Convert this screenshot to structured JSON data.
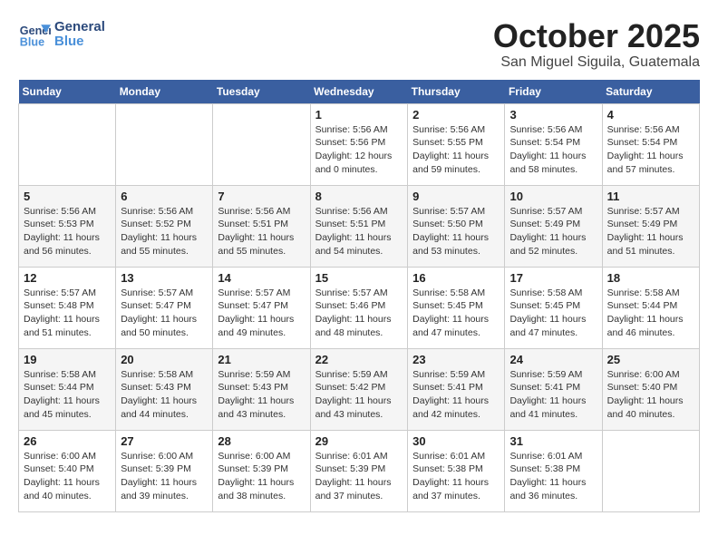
{
  "header": {
    "logo_line1": "General",
    "logo_line2": "Blue",
    "month_title": "October 2025",
    "location": "San Miguel Siguila, Guatemala"
  },
  "weekdays": [
    "Sunday",
    "Monday",
    "Tuesday",
    "Wednesday",
    "Thursday",
    "Friday",
    "Saturday"
  ],
  "weeks": [
    [
      {
        "day": "",
        "info": ""
      },
      {
        "day": "",
        "info": ""
      },
      {
        "day": "",
        "info": ""
      },
      {
        "day": "1",
        "info": "Sunrise: 5:56 AM\nSunset: 5:56 PM\nDaylight: 12 hours\nand 0 minutes."
      },
      {
        "day": "2",
        "info": "Sunrise: 5:56 AM\nSunset: 5:55 PM\nDaylight: 11 hours\nand 59 minutes."
      },
      {
        "day": "3",
        "info": "Sunrise: 5:56 AM\nSunset: 5:54 PM\nDaylight: 11 hours\nand 58 minutes."
      },
      {
        "day": "4",
        "info": "Sunrise: 5:56 AM\nSunset: 5:54 PM\nDaylight: 11 hours\nand 57 minutes."
      }
    ],
    [
      {
        "day": "5",
        "info": "Sunrise: 5:56 AM\nSunset: 5:53 PM\nDaylight: 11 hours\nand 56 minutes."
      },
      {
        "day": "6",
        "info": "Sunrise: 5:56 AM\nSunset: 5:52 PM\nDaylight: 11 hours\nand 55 minutes."
      },
      {
        "day": "7",
        "info": "Sunrise: 5:56 AM\nSunset: 5:51 PM\nDaylight: 11 hours\nand 55 minutes."
      },
      {
        "day": "8",
        "info": "Sunrise: 5:56 AM\nSunset: 5:51 PM\nDaylight: 11 hours\nand 54 minutes."
      },
      {
        "day": "9",
        "info": "Sunrise: 5:57 AM\nSunset: 5:50 PM\nDaylight: 11 hours\nand 53 minutes."
      },
      {
        "day": "10",
        "info": "Sunrise: 5:57 AM\nSunset: 5:49 PM\nDaylight: 11 hours\nand 52 minutes."
      },
      {
        "day": "11",
        "info": "Sunrise: 5:57 AM\nSunset: 5:49 PM\nDaylight: 11 hours\nand 51 minutes."
      }
    ],
    [
      {
        "day": "12",
        "info": "Sunrise: 5:57 AM\nSunset: 5:48 PM\nDaylight: 11 hours\nand 51 minutes."
      },
      {
        "day": "13",
        "info": "Sunrise: 5:57 AM\nSunset: 5:47 PM\nDaylight: 11 hours\nand 50 minutes."
      },
      {
        "day": "14",
        "info": "Sunrise: 5:57 AM\nSunset: 5:47 PM\nDaylight: 11 hours\nand 49 minutes."
      },
      {
        "day": "15",
        "info": "Sunrise: 5:57 AM\nSunset: 5:46 PM\nDaylight: 11 hours\nand 48 minutes."
      },
      {
        "day": "16",
        "info": "Sunrise: 5:58 AM\nSunset: 5:45 PM\nDaylight: 11 hours\nand 47 minutes."
      },
      {
        "day": "17",
        "info": "Sunrise: 5:58 AM\nSunset: 5:45 PM\nDaylight: 11 hours\nand 47 minutes."
      },
      {
        "day": "18",
        "info": "Sunrise: 5:58 AM\nSunset: 5:44 PM\nDaylight: 11 hours\nand 46 minutes."
      }
    ],
    [
      {
        "day": "19",
        "info": "Sunrise: 5:58 AM\nSunset: 5:44 PM\nDaylight: 11 hours\nand 45 minutes."
      },
      {
        "day": "20",
        "info": "Sunrise: 5:58 AM\nSunset: 5:43 PM\nDaylight: 11 hours\nand 44 minutes."
      },
      {
        "day": "21",
        "info": "Sunrise: 5:59 AM\nSunset: 5:43 PM\nDaylight: 11 hours\nand 43 minutes."
      },
      {
        "day": "22",
        "info": "Sunrise: 5:59 AM\nSunset: 5:42 PM\nDaylight: 11 hours\nand 43 minutes."
      },
      {
        "day": "23",
        "info": "Sunrise: 5:59 AM\nSunset: 5:41 PM\nDaylight: 11 hours\nand 42 minutes."
      },
      {
        "day": "24",
        "info": "Sunrise: 5:59 AM\nSunset: 5:41 PM\nDaylight: 11 hours\nand 41 minutes."
      },
      {
        "day": "25",
        "info": "Sunrise: 6:00 AM\nSunset: 5:40 PM\nDaylight: 11 hours\nand 40 minutes."
      }
    ],
    [
      {
        "day": "26",
        "info": "Sunrise: 6:00 AM\nSunset: 5:40 PM\nDaylight: 11 hours\nand 40 minutes."
      },
      {
        "day": "27",
        "info": "Sunrise: 6:00 AM\nSunset: 5:39 PM\nDaylight: 11 hours\nand 39 minutes."
      },
      {
        "day": "28",
        "info": "Sunrise: 6:00 AM\nSunset: 5:39 PM\nDaylight: 11 hours\nand 38 minutes."
      },
      {
        "day": "29",
        "info": "Sunrise: 6:01 AM\nSunset: 5:39 PM\nDaylight: 11 hours\nand 37 minutes."
      },
      {
        "day": "30",
        "info": "Sunrise: 6:01 AM\nSunset: 5:38 PM\nDaylight: 11 hours\nand 37 minutes."
      },
      {
        "day": "31",
        "info": "Sunrise: 6:01 AM\nSunset: 5:38 PM\nDaylight: 11 hours\nand 36 minutes."
      },
      {
        "day": "",
        "info": ""
      }
    ]
  ]
}
